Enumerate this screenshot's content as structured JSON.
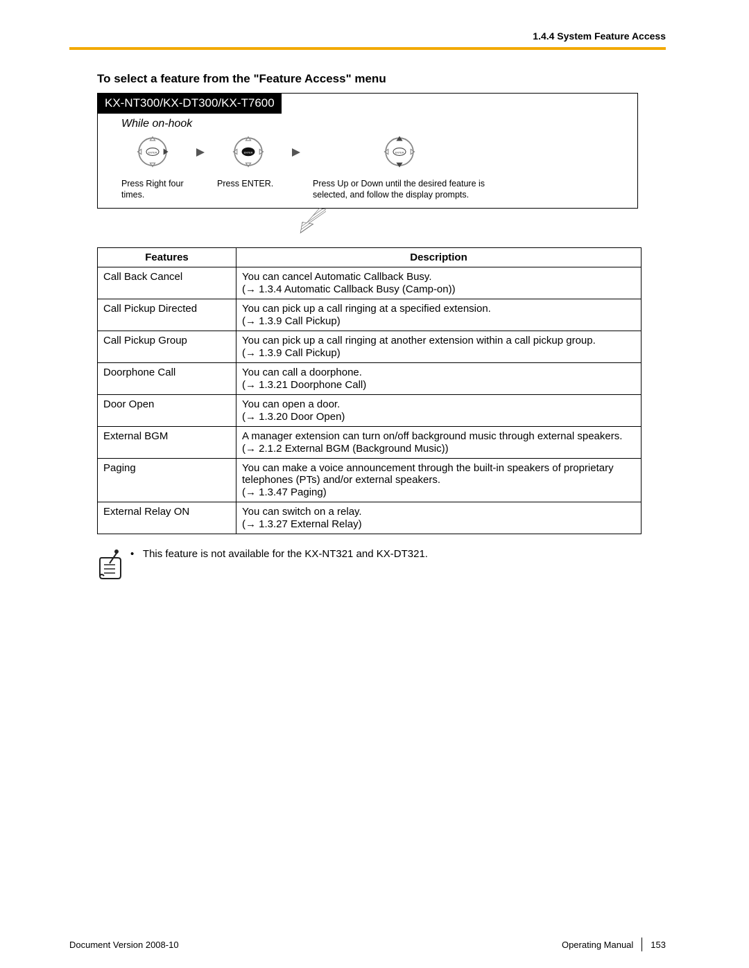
{
  "header": {
    "breadcrumb": "1.4.4 System Feature Access"
  },
  "section": {
    "title": "To select a feature from the \"Feature Access\" menu"
  },
  "procedure": {
    "model_label": "KX-NT300/KX-DT300/KX-T7600",
    "condition": "While on-hook",
    "step1_caption": "Press Right four times.",
    "step2_caption": "Press ENTER.",
    "step3_caption": "Press Up or Down until the desired feature is selected, and follow the display prompts."
  },
  "table": {
    "head_features": "Features",
    "head_description": "Description",
    "rows": [
      {
        "feature": "Call Back Cancel",
        "desc": "You can cancel Automatic Callback Busy.",
        "ref": "(→ 1.3.4  Automatic Callback Busy (Camp-on))"
      },
      {
        "feature": "Call Pickup Directed",
        "desc": "You can pick up a call ringing at a specified extension.",
        "ref": "(→ 1.3.9  Call Pickup)"
      },
      {
        "feature": "Call Pickup Group",
        "desc": "You can pick up a call ringing at another extension within a call pickup group.",
        "ref": "(→ 1.3.9  Call Pickup)"
      },
      {
        "feature": "Doorphone Call",
        "desc": "You can call a doorphone.",
        "ref": "(→ 1.3.21  Doorphone Call)"
      },
      {
        "feature": "Door Open",
        "desc": "You can open a door.",
        "ref": "(→ 1.3.20  Door Open)"
      },
      {
        "feature": "External BGM",
        "desc": "A manager extension can turn on/off background music through external speakers.",
        "ref": "(→ 2.1.2  External BGM (Background Music))"
      },
      {
        "feature": "Paging",
        "desc": "You can make a voice announcement through the built-in speakers of proprietary telephones (PTs) and/or external speakers.",
        "ref": "(→ 1.3.47  Paging)"
      },
      {
        "feature": "External Relay ON",
        "desc": "You can switch on a relay.",
        "ref": "(→ 1.3.27  External Relay)"
      }
    ]
  },
  "note": {
    "text": "This feature is not available for the KX-NT321 and KX-DT321."
  },
  "footer": {
    "doc_version": "Document Version  2008-10",
    "manual": "Operating Manual",
    "page": "153"
  }
}
